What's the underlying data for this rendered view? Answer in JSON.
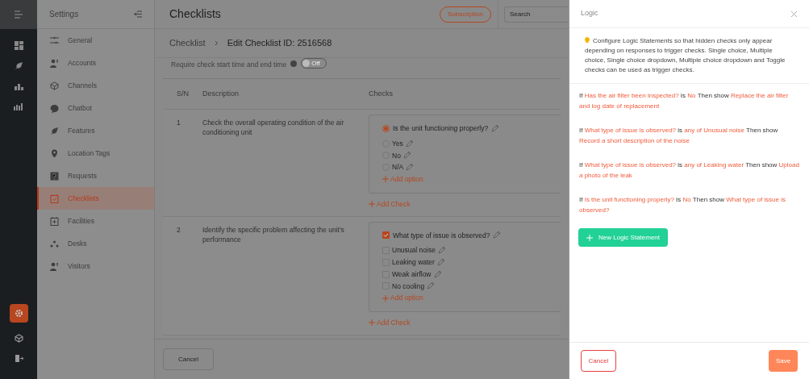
{
  "settings_sidebar": {
    "title": "Settings",
    "items": [
      {
        "label": "General",
        "selected": false
      },
      {
        "label": "Accounts",
        "selected": false
      },
      {
        "label": "Channels",
        "selected": false
      },
      {
        "label": "Chatbot",
        "selected": false
      },
      {
        "label": "Features",
        "selected": false
      },
      {
        "label": "Location Tags",
        "selected": false
      },
      {
        "label": "Requests",
        "selected": false
      },
      {
        "label": "Checklists",
        "selected": true
      },
      {
        "label": "Facilities",
        "selected": false
      },
      {
        "label": "Desks",
        "selected": false
      },
      {
        "label": "Visitors",
        "selected": false
      }
    ]
  },
  "header": {
    "title": "Checklists",
    "subscription_button": "Subscription",
    "search": {
      "placeholder": "Search"
    }
  },
  "breadcrumb": {
    "parent": "Checklist",
    "current": "Edit Checklist ID: 2516568"
  },
  "require_time": {
    "label": "Require check start time and end time",
    "toggle_label": "Off",
    "on": false
  },
  "table": {
    "columns": [
      "S/N",
      "Description",
      "Checks"
    ],
    "rows": [
      {
        "sn": "1",
        "description": "Check the overall operating condition of the air conditioning unit",
        "check": {
          "kind": "radio",
          "question": "Is the unit functioning properly?",
          "checked": true,
          "options": [
            {
              "label": "Yes",
              "selected": false
            },
            {
              "label": "No",
              "selected": false
            },
            {
              "label": "N/A",
              "selected": false
            }
          ],
          "add_option": "Add option"
        },
        "add_check": "Add Check"
      },
      {
        "sn": "2",
        "description": "Identify the specific problem affecting the unit's performance",
        "check": {
          "kind": "checkbox",
          "question": "What type of issue is observed?",
          "checked": true,
          "options": [
            {
              "label": "Unusual noise",
              "selected": false
            },
            {
              "label": "Leaking water",
              "selected": false
            },
            {
              "label": "Weak airflow",
              "selected": false
            },
            {
              "label": "No cooling",
              "selected": false
            }
          ],
          "add_option": "Add option"
        },
        "add_check": "Add Check"
      }
    ]
  },
  "footer": {
    "cancel_button": "Cancel"
  },
  "logic_panel": {
    "title": "Logic",
    "info": "Configure Logic Statements so that hidden checks only appear depending on responses to trigger checks. Single choice, Multiple choice, Single choice dropdown, Multiple choice dropdown and Toggle checks can be used as trigger checks.",
    "statements": [
      [
        {
          "kind": "keyword",
          "text": "If"
        },
        {
          "kind": "value",
          "text": "Has the air filter been inspected?"
        },
        {
          "kind": "keyword",
          "text": "Is"
        },
        {
          "kind": "value",
          "text": "No"
        },
        {
          "kind": "keyword",
          "text": "Then show"
        },
        {
          "kind": "value",
          "text": "Replace the air filter and log date of replacement"
        }
      ],
      [
        {
          "kind": "keyword",
          "text": "If"
        },
        {
          "kind": "value",
          "text": "What type of issue is observed?"
        },
        {
          "kind": "keyword",
          "text": "is"
        },
        {
          "kind": "value",
          "text": "any of Unusual noise"
        },
        {
          "kind": "keyword",
          "text": "Then show"
        },
        {
          "kind": "value",
          "text": "Record a short description of the noise"
        }
      ],
      [
        {
          "kind": "keyword",
          "text": "If"
        },
        {
          "kind": "value",
          "text": "What type of issue is observed?"
        },
        {
          "kind": "keyword",
          "text": "is"
        },
        {
          "kind": "value",
          "text": "any of Leaking water"
        },
        {
          "kind": "keyword",
          "text": "Then show"
        },
        {
          "kind": "value",
          "text": "Upload a photo of the leak"
        }
      ],
      [
        {
          "kind": "keyword",
          "text": "If"
        },
        {
          "kind": "value",
          "text": "Is the unit functioning properly?"
        },
        {
          "kind": "keyword",
          "text": "Is"
        },
        {
          "kind": "value",
          "text": "No"
        },
        {
          "kind": "keyword",
          "text": "Then show"
        },
        {
          "kind": "value",
          "text": "What type of issue is observed?"
        }
      ]
    ],
    "new_button": "New Logic Statement",
    "cancel_button": "Cancel",
    "save_button": "Save"
  }
}
